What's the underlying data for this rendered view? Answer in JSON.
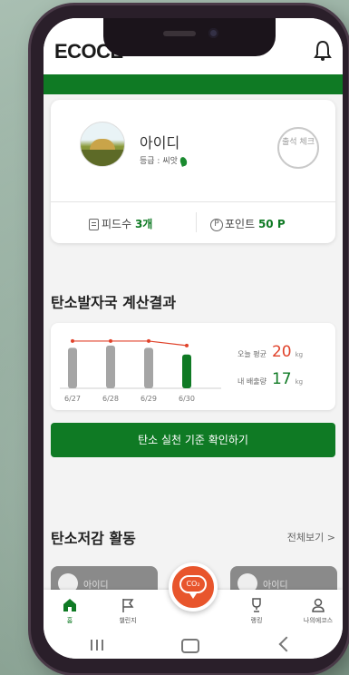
{
  "app": {
    "logo": "ECOCE"
  },
  "profile": {
    "name": "아이디",
    "grade": "등급 : 씨앗",
    "stamp_label": "출석 체크",
    "feeds_label": "피드수",
    "feeds_value": "3개",
    "points_label": "포인트",
    "points_value": "50 P"
  },
  "result": {
    "title": "탄소발자국 계산결과",
    "avg_label": "오늘 평균",
    "avg_value": "20",
    "avg_unit": "kg",
    "mine_label": "내 배출량",
    "mine_value": "17",
    "mine_unit": "kg",
    "cta_label": "탄소 실천 기준 확인하기"
  },
  "chart_data": {
    "type": "bar",
    "categories": [
      "6/27",
      "6/28",
      "6/29",
      "6/30"
    ],
    "series": [
      {
        "name": "내 배출량",
        "values": [
          18,
          19,
          18,
          15
        ],
        "colors": [
          "#a5a5a5",
          "#a5a5a5",
          "#a5a5a5",
          "#0f7a24"
        ]
      },
      {
        "name": "오늘 평균",
        "type": "line",
        "values": [
          21,
          21,
          21,
          19
        ],
        "color": "#e0422a"
      }
    ],
    "ylim": [
      0,
      25
    ],
    "grid": false
  },
  "activity": {
    "title": "탄소저감 활동",
    "view_all": "전체보기 >",
    "cards": [
      {
        "name": "아이디"
      },
      {
        "name": "아이디"
      }
    ]
  },
  "tabbar": {
    "home": "홈",
    "challenge": "챌린지",
    "fab_label": "CO₂",
    "rank": "랭킹",
    "my": "나의에코스"
  },
  "colors": {
    "brand": "#0f7a24",
    "accent": "#e8552c",
    "avg": "#e0422a"
  }
}
